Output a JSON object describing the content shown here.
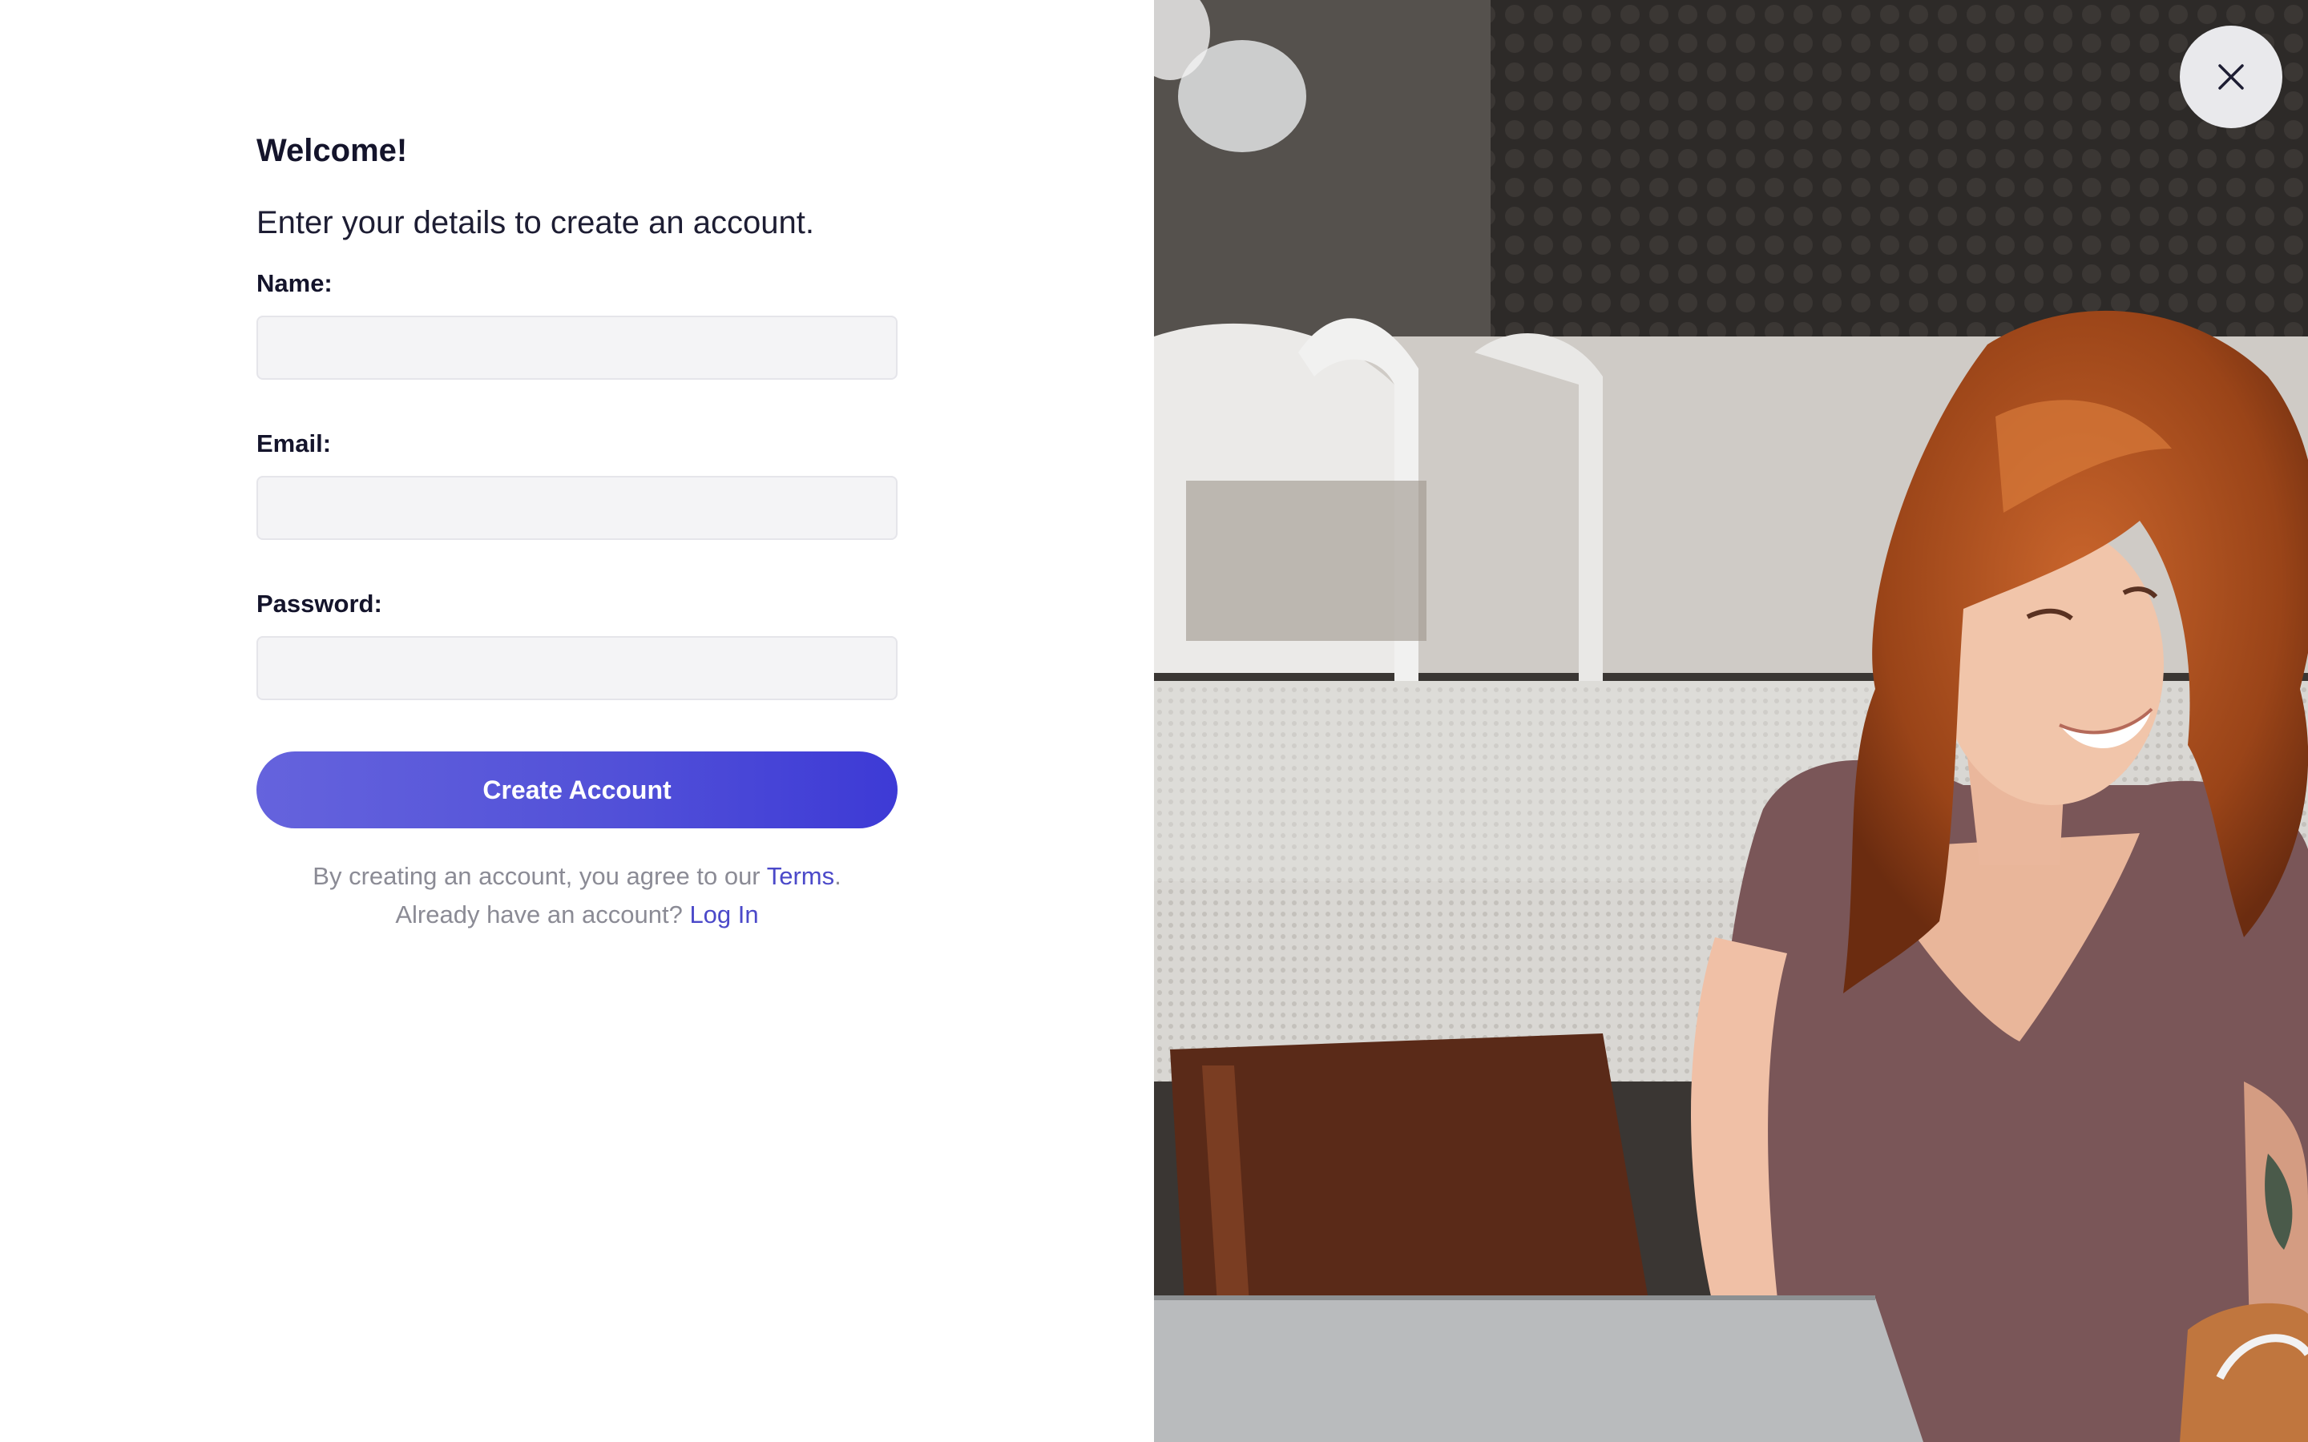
{
  "form": {
    "heading": "Welcome!",
    "subtitle": "Enter your details to create an account.",
    "fields": {
      "name": {
        "label": "Name:",
        "value": "",
        "placeholder": ""
      },
      "email": {
        "label": "Email:",
        "value": "",
        "placeholder": ""
      },
      "password": {
        "label": "Password:",
        "value": "",
        "placeholder": ""
      }
    },
    "submit_label": "Create Account",
    "terms_prefix": "By creating an account, you agree to our",
    "terms_link": "Terms",
    "terms_suffix": ".",
    "login_prefix": "Already have an account?",
    "login_link": "Log In"
  },
  "photo": {
    "icon": "photo-woman-laptop"
  },
  "close": {
    "icon": "close-icon"
  },
  "colors": {
    "accent": "#4b49c9",
    "button_gradient_start": "#6563dd",
    "button_gradient_end": "#3d3ad6",
    "input_bg": "#f4f4f6",
    "text_primary": "#14142b",
    "text_muted": "#8b8b95"
  }
}
